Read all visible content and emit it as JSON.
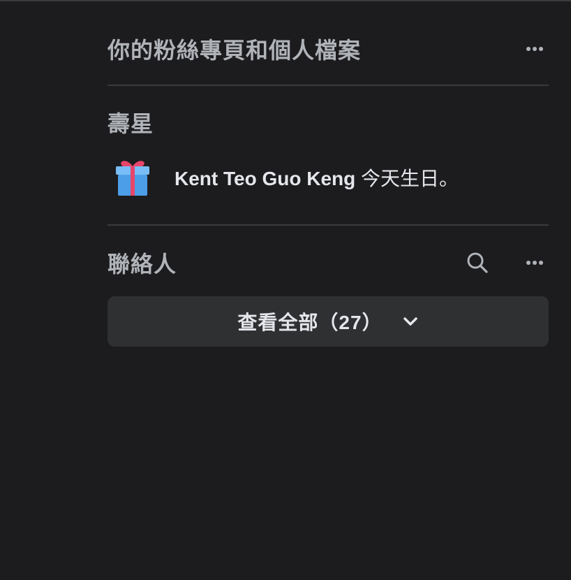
{
  "pages_section": {
    "title": "你的粉絲專頁和個人檔案"
  },
  "birthdays_section": {
    "title": "壽星",
    "name": "Kent Teo Guo Keng",
    "message": " 今天生日。",
    "icon": "gift-icon"
  },
  "contacts_section": {
    "title": "聯絡人",
    "see_all_label": "查看全部（27）"
  },
  "colors": {
    "background": "#1c1c1e",
    "divider": "#3a3b3c",
    "button_bg": "#2f3031",
    "secondary_text": "#b0b3b8",
    "primary_text": "#e4e6eb",
    "gift_box": "#5aa9f0",
    "gift_ribbon": "#e8456b"
  }
}
